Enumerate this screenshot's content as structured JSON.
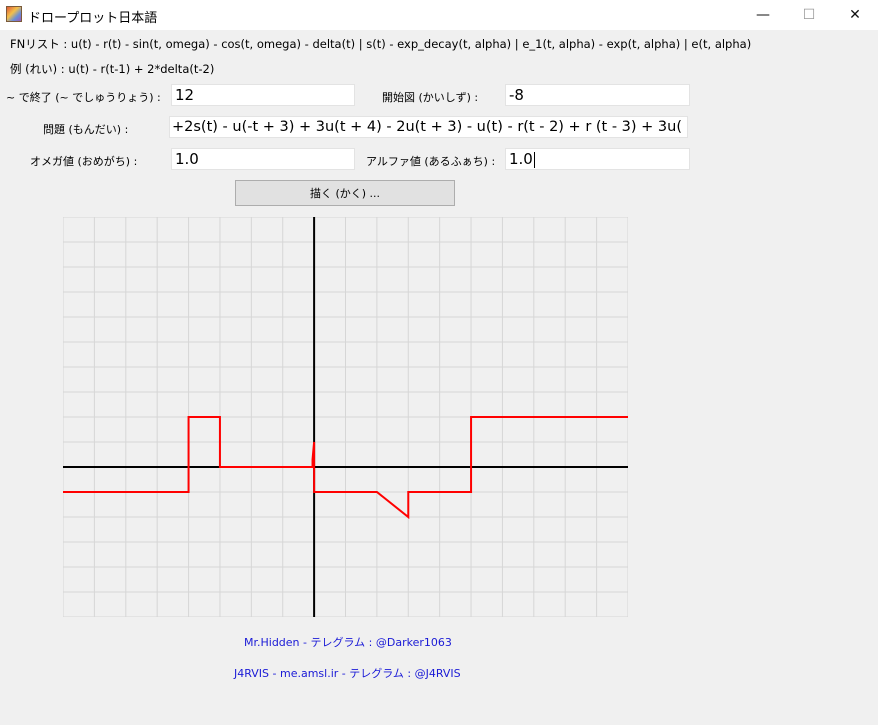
{
  "window": {
    "title": "ドロープロット日本語",
    "minimize_glyph": "—",
    "maximize_glyph": "☐",
    "close_glyph": "✕"
  },
  "info": {
    "fn_list": "FNリスト : u(t) - r(t) - sin(t, omega) - cos(t, omega) - delta(t) | s(t) - exp_decay(t, alpha) | e_1(t, alpha) - exp(t, alpha) | e(t, alpha)",
    "example": "例 (れい) : u(t) - r(t-1) + 2*delta(t-2)"
  },
  "form": {
    "end_label": "~ で終了 (~ でしゅうりょう) :",
    "end_value": "12",
    "start_label": "開始図 (かいしず) :",
    "start_value": "-8",
    "problem_label": "問題 (もんだい) :",
    "problem_value": "+2s(t) - u(-t + 3) + 3u(t + 4) - 2u(t + 3) - u(t) - r(t - 2) + r (t - 3) + 3u( t - 5)",
    "omega_label": "オメガ値 (おめがち) :",
    "omega_value": "1.0",
    "alpha_label": "アルファ値 (あるふぁち) :",
    "alpha_value": "1.0",
    "draw_button": "描く (かく) ..."
  },
  "chart_data": {
    "type": "line",
    "xlim": [
      -8,
      10
    ],
    "ylim": [
      -6,
      10
    ],
    "grid": true,
    "series": [
      {
        "color": "#ff0000",
        "x": [
          -8,
          -4.0,
          -4.0,
          -3.0,
          -3.0,
          -0.05,
          -0.05,
          0,
          0,
          0.05,
          0.05,
          2,
          3,
          3,
          5,
          5,
          10
        ],
        "y": [
          -1,
          -1,
          2,
          2,
          0,
          0,
          0.3,
          1,
          -1,
          -1,
          -1,
          -1,
          -2,
          -1,
          -1,
          2,
          2
        ]
      }
    ]
  },
  "credits": {
    "line1": "Mr.Hidden - テレグラム : @Darker1063",
    "line2": "J4RVIS - me.amsl.ir - テレグラム : @J4RVIS"
  }
}
